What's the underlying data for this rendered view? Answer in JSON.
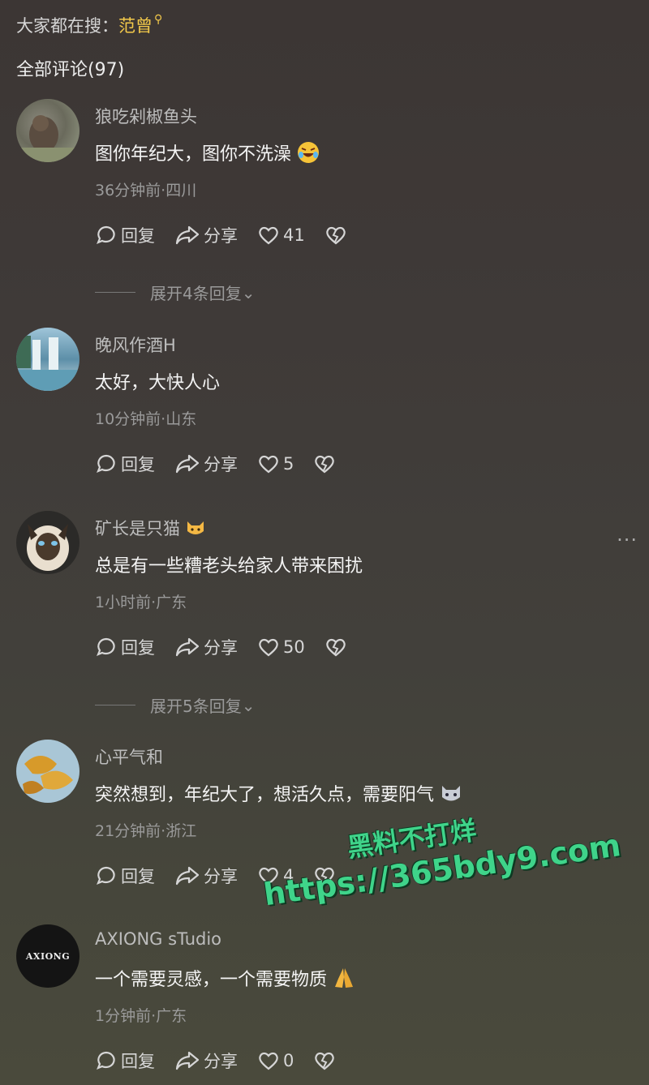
{
  "search": {
    "prefix": "大家都在搜：",
    "keyword": "范曾"
  },
  "comments_header": {
    "label": "全部评论(97)"
  },
  "actions": {
    "reply": "回复",
    "share": "分享"
  },
  "comments": [
    {
      "user": "狼吃剁椒鱼头",
      "text": "图你年纪大，图你不洗澡",
      "time_loc": "36分钟前·四川",
      "likes": "41",
      "expand": "展开4条回复"
    },
    {
      "user": "晚风作酒H",
      "text": "太好，大快人心",
      "time_loc": "10分钟前·山东",
      "likes": "5",
      "expand": ""
    },
    {
      "user": "矿长是只猫",
      "text": "总是有一些糟老头给家人带来困扰",
      "time_loc": "1小时前·广东",
      "likes": "50",
      "expand": "展开5条回复"
    },
    {
      "user": "心平气和",
      "text": "突然想到，年纪大了，想活久点，需要阳气",
      "time_loc": "21分钟前·浙江",
      "likes": "4",
      "expand": ""
    },
    {
      "user": "AXIONG sTudio",
      "text": "一个需要灵感，一个需要物质",
      "time_loc": "1分钟前·广东",
      "likes": "0",
      "expand": ""
    }
  ],
  "avatar_logo_text": "AXIONG",
  "more_menu": "···",
  "watermark": {
    "line1": "黑料不打烊",
    "line2": "https://365bdy9.com"
  }
}
